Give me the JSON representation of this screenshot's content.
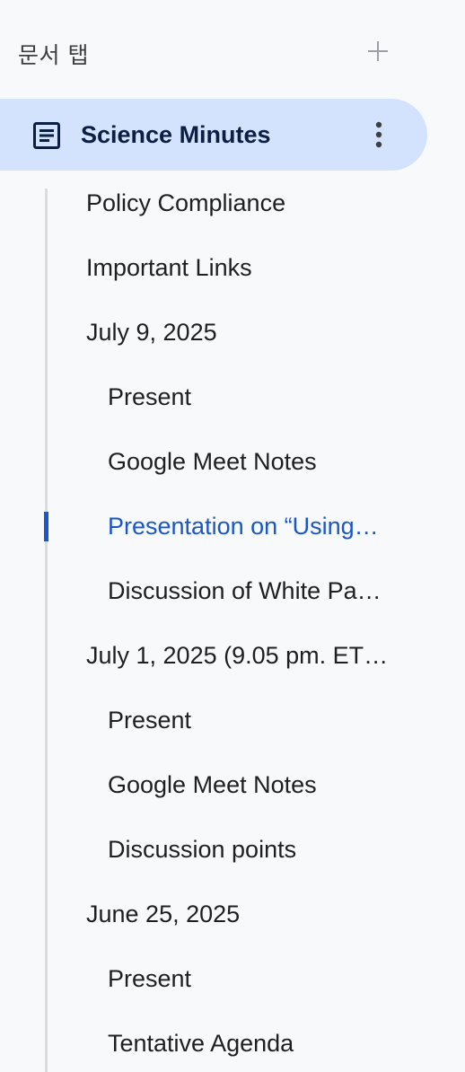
{
  "header": {
    "title": "문서 탭",
    "add_icon": "plus-icon"
  },
  "active_tab": {
    "label": "Science Minutes",
    "icon": "document-icon",
    "menu_icon": "more-vertical-icon"
  },
  "colors": {
    "background": "#f8f9fb",
    "active_tab_bg": "#d3e3fd",
    "active_text": "#1a56c7",
    "outline_line": "#dadce0"
  },
  "outline": {
    "items": [
      {
        "label": "Policy Compliance",
        "level": 1,
        "current": false
      },
      {
        "label": "Important Links",
        "level": 1,
        "current": false
      },
      {
        "label": "July 9, 2025",
        "level": 1,
        "current": false
      },
      {
        "label": "Present",
        "level": 2,
        "current": false
      },
      {
        "label": "Google Meet Notes",
        "level": 2,
        "current": false
      },
      {
        "label": "Presentation on “Using…",
        "level": 2,
        "current": true
      },
      {
        "label": "Discussion of White Pa…",
        "level": 2,
        "current": false
      },
      {
        "label": "July 1, 2025 (9.05 pm. ET…",
        "level": 1,
        "current": false
      },
      {
        "label": "Present",
        "level": 2,
        "current": false
      },
      {
        "label": "Google Meet Notes",
        "level": 2,
        "current": false
      },
      {
        "label": "Discussion points",
        "level": 2,
        "current": false
      },
      {
        "label": "June 25, 2025",
        "level": 1,
        "current": false
      },
      {
        "label": "Present",
        "level": 2,
        "current": false
      },
      {
        "label": "Tentative Agenda",
        "level": 2,
        "current": false
      }
    ]
  }
}
